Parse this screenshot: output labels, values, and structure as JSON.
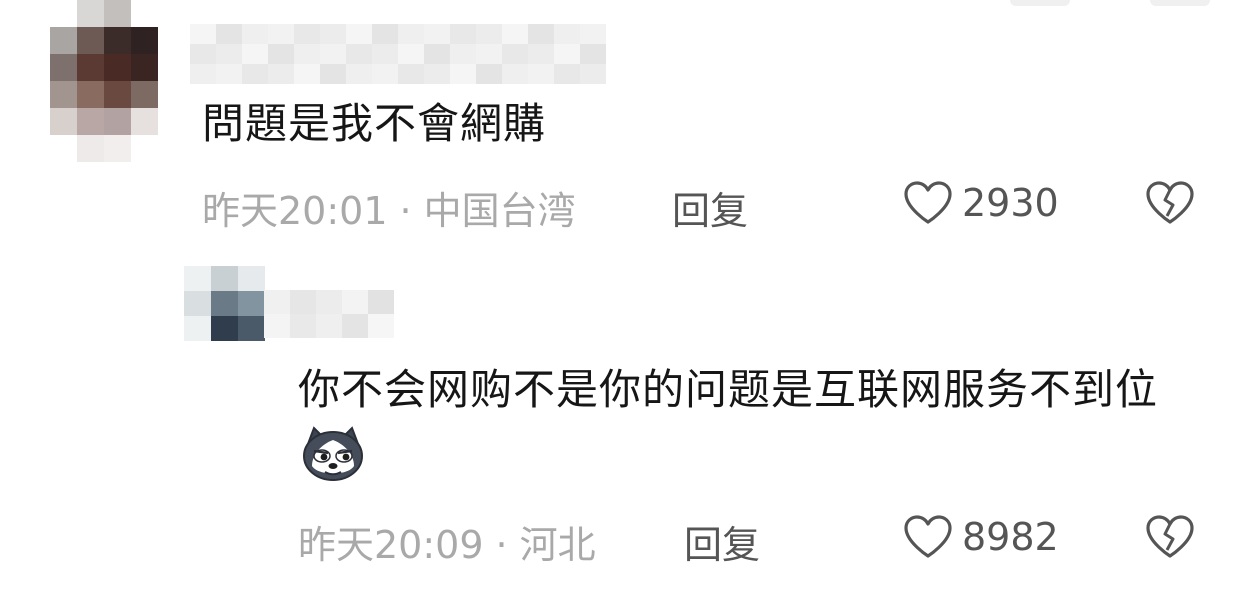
{
  "comments": [
    {
      "text": "問題是我不會網購",
      "time": "昨天20:01",
      "separator": "·",
      "location": "中国台湾",
      "reply_label": "回复",
      "likes": "2930",
      "avatar_icon": "blurred-avatar",
      "like_icon": "heart-outline-icon",
      "dislike_icon": "broken-heart-icon"
    },
    {
      "text": "你不会网购不是你的问题是互联网服务不到位",
      "time": "昨天20:09",
      "separator": "·",
      "location": "河北",
      "reply_label": "回复",
      "likes": "8982",
      "avatar_icon": "blurred-avatar",
      "emoji_icon": "husky-dog-emoji-icon",
      "like_icon": "heart-outline-icon",
      "dislike_icon": "broken-heart-icon"
    }
  ],
  "colors": {
    "text": "#161616",
    "meta": "#a9a9a9",
    "action": "#555555"
  }
}
